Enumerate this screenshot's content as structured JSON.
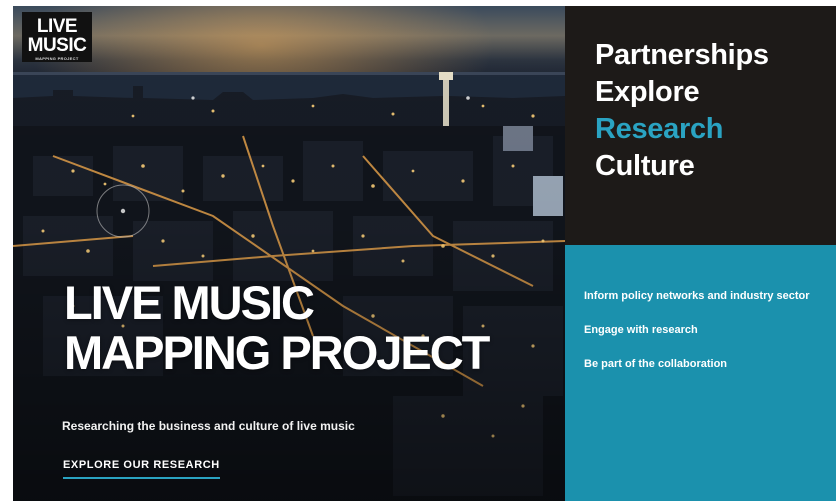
{
  "logo": {
    "line1": "LIVE",
    "line2": "MUSIC",
    "line3": "MAPPING PROJECT"
  },
  "hero": {
    "title_line1": "LIVE MUSIC",
    "title_line2": "MAPPING PROJECT",
    "subtitle": "Researching the business and culture of live music",
    "cta": "EXPLORE OUR RESEARCH",
    "image": "night-cityscape-photo"
  },
  "feature_words": {
    "items": [
      "Partnerships",
      "Explore",
      "Research",
      "Culture"
    ],
    "highlighted": "Research"
  },
  "quick_links": {
    "items": [
      "Inform policy networks and industry sector",
      "Engage with research",
      "Be part of the collaboration"
    ]
  },
  "colors": {
    "accent": "#2aa3c2",
    "panel_teal": "#1b91ad",
    "panel_dark": "#1d1a18",
    "text": "#ffffff"
  }
}
